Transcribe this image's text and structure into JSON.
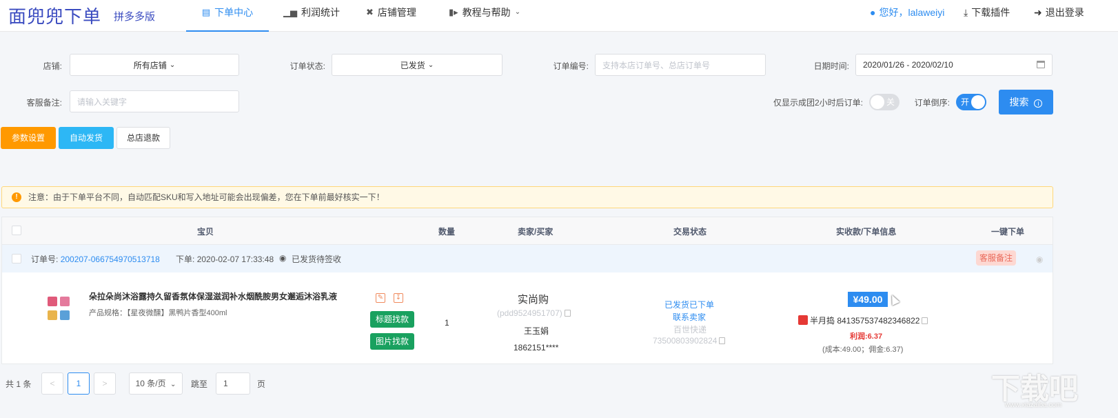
{
  "header": {
    "logo": "面兜兜下单",
    "logo_sub": "拼多多版",
    "nav": [
      {
        "label": "下单中心",
        "icon": "document-icon"
      },
      {
        "label": "利润统计",
        "icon": "bar-chart-icon"
      },
      {
        "label": "店铺管理",
        "icon": "tools-icon"
      },
      {
        "label": "教程与帮助",
        "icon": "video-icon"
      }
    ],
    "user": "您好，lalaweiyi",
    "download": "下载插件",
    "logout": "退出登录"
  },
  "filters": {
    "shop_label": "店铺:",
    "shop_value": "所有店铺",
    "status_label": "订单状态:",
    "status_value": "已发货",
    "order_no_label": "订单编号:",
    "order_no_placeholder": "支持本店订单号、总店订单号",
    "date_label": "日期时间:",
    "date_value": "2020/01/26 - 2020/02/10",
    "remark_label": "客服备注:",
    "remark_placeholder": "请输入关键字",
    "only_2h_label": "仅显示成团2小时后订单:",
    "only_2h_toggle": "关",
    "reverse_label": "订单倒序:",
    "reverse_toggle": "开",
    "search_button": "搜索"
  },
  "actions": {
    "params": "参数设置",
    "auto_ship": "自动发货",
    "refund": "总店退款"
  },
  "notice": "注意：由于下单平台不同，自动匹配SKU和写入地址可能会出现偏差，您在下单前最好核实一下！",
  "table": {
    "headers": [
      "宝贝",
      "数量",
      "卖家/买家",
      "交易状态",
      "实收款/下单信息",
      "一键下单"
    ],
    "order": {
      "order_no_label": "订单号:",
      "order_no": "200207-066754970513718",
      "order_time_label": "下单:",
      "order_time": "2020-02-07 17:33:48",
      "ship_status": "已发货待签收",
      "note_tag": "客服备注",
      "product_title": "朵拉朵尚沐浴露持久留香氛体保湿滋润补水烟酰胺男女邂逅沐浴乳液",
      "product_spec": "产品规格：【星夜微醺】黑鸭片香型400ml",
      "btn_title_find": "标题找款",
      "btn_image_find": "图片找款",
      "quantity": "1",
      "seller": "实尚购",
      "seller_id": "(pdd9524951707)",
      "buyer": "王玉娟",
      "buyer_phone": "1862151****",
      "trade_status": "已发货已下单",
      "contact_seller": "联系卖家",
      "express": "百世快递",
      "tracking_no": "73500803902824",
      "price": "¥49.00",
      "platform_order": "半月捣 841357537482346822",
      "profit": "利润:6.37",
      "cost_detail": "(成本:49.00；佣金:6.37)"
    }
  },
  "pagination": {
    "total": "共 1 条",
    "prev": "<",
    "page": "1",
    "next": ">",
    "page_size": "10 条/页",
    "goto_label": "跳至",
    "goto_value": "1",
    "page_unit": "页"
  },
  "watermark": {
    "main": "下载吧",
    "sub": "www.xiazaiba.com"
  },
  "colors": {
    "primary": "#2d8cf0",
    "orange": "#ff9900",
    "cyan": "#2db7f5",
    "green": "#19a15f",
    "red": "#e53935"
  }
}
